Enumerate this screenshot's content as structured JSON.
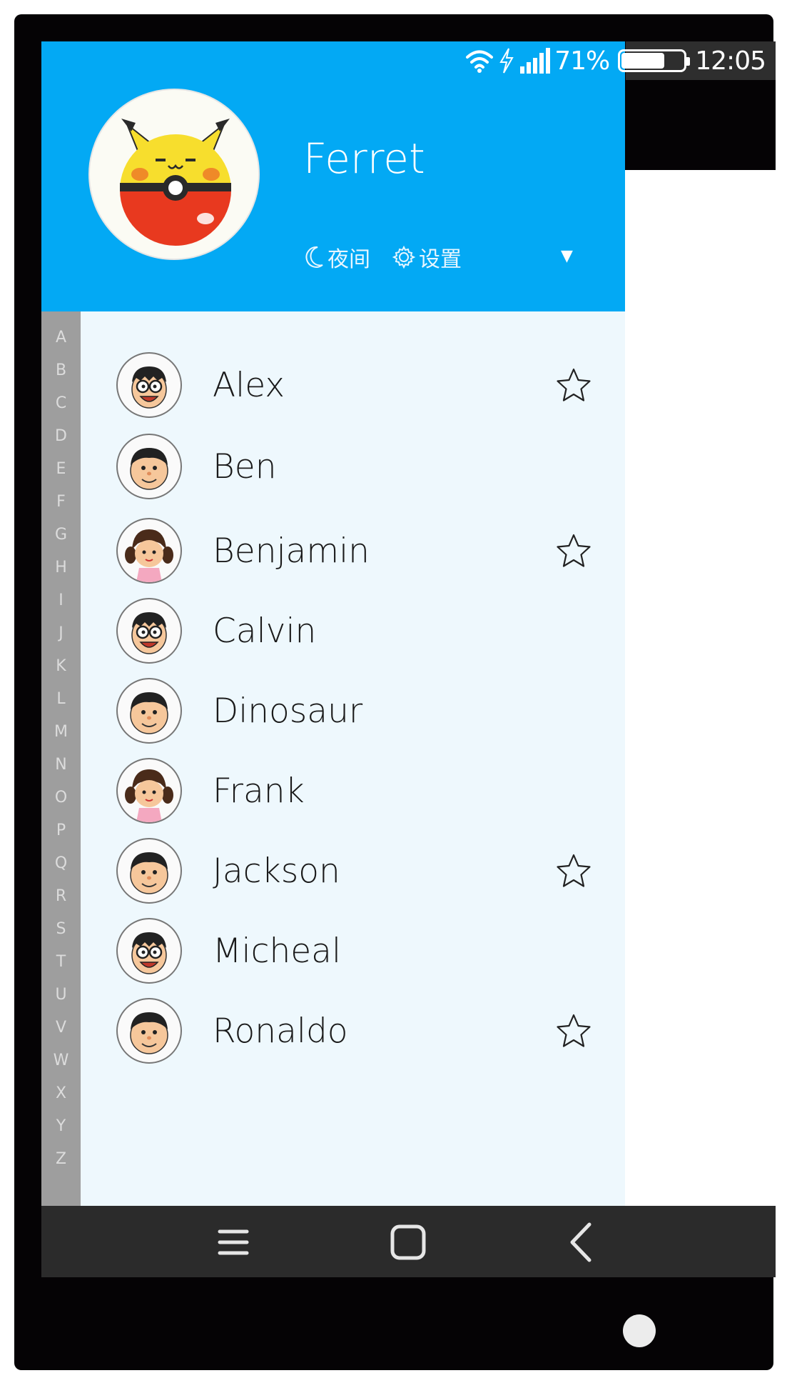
{
  "status_bar": {
    "battery_text": "71%",
    "battery_level": 0.71,
    "time": "12:05"
  },
  "profile": {
    "name": "Ferret",
    "night_label": "夜间",
    "settings_label": "设置"
  },
  "index_letters": [
    "A",
    "B",
    "C",
    "D",
    "E",
    "F",
    "G",
    "H",
    "I",
    "J",
    "K",
    "L",
    "M",
    "N",
    "O",
    "P",
    "Q",
    "R",
    "S",
    "T",
    "U",
    "V",
    "W",
    "X",
    "Y",
    "Z"
  ],
  "contacts": [
    {
      "name": "Alex",
      "avatar": "nobita",
      "starred": true
    },
    {
      "name": "Ben",
      "avatar": "gian",
      "starred": false
    },
    {
      "name": "Benjamin",
      "avatar": "shizuka",
      "starred": true
    },
    {
      "name": "Calvin",
      "avatar": "nobita",
      "starred": false
    },
    {
      "name": "Dinosaur",
      "avatar": "gian",
      "starred": false
    },
    {
      "name": "Frank",
      "avatar": "shizuka",
      "starred": false
    },
    {
      "name": "Jackson",
      "avatar": "gian",
      "starred": true
    },
    {
      "name": "Micheal",
      "avatar": "nobita",
      "starred": false
    },
    {
      "name": "Ronaldo",
      "avatar": "gian",
      "starred": true
    }
  ],
  "colors": {
    "header": "#03a9f4",
    "list_bg": "#eef8fd",
    "index_bar": "#9e9e9e",
    "nav_bar": "#2b2b2b"
  },
  "icons": {
    "night": "moon-icon",
    "settings": "gear-icon",
    "dropdown": "caret-down-icon",
    "star": "star-outline-icon",
    "nav_menu": "menu-icon",
    "nav_home": "home-square-icon",
    "nav_back": "back-chevron-icon"
  }
}
